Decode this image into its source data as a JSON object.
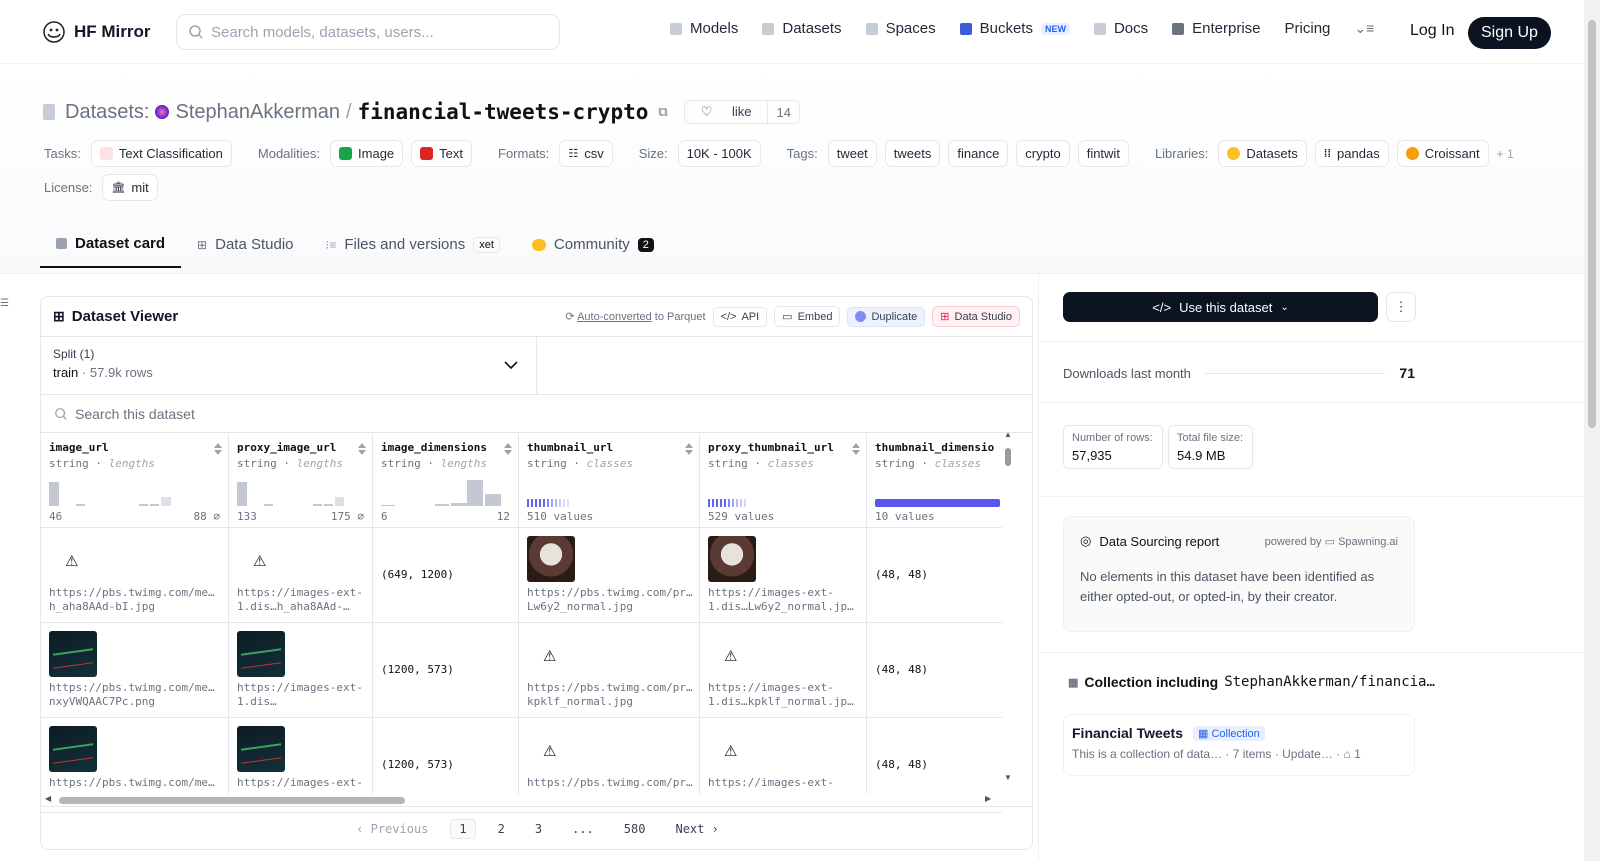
{
  "header": {
    "brand": "HF Mirror",
    "search_placeholder": "Search models, datasets, users...",
    "nav": [
      {
        "label": "Models",
        "icon": "cube-icon"
      },
      {
        "label": "Datasets",
        "icon": "database-icon"
      },
      {
        "label": "Spaces",
        "icon": "grid-icon"
      },
      {
        "label": "Buckets",
        "icon": "bucket-icon",
        "badge": "NEW"
      },
      {
        "label": "Docs",
        "icon": "book-icon"
      },
      {
        "label": "Enterprise",
        "icon": "briefcase-icon"
      },
      {
        "label": "Pricing"
      }
    ],
    "login": "Log In",
    "signup": "Sign Up"
  },
  "repo": {
    "prefix": "Datasets:",
    "owner": "StephanAkkerman",
    "sep": "/",
    "name": "financial-tweets-crypto",
    "like_label": "like",
    "like_count": "14"
  },
  "tags": {
    "tasks_label": "Tasks:",
    "tasks": [
      "Text Classification"
    ],
    "modalities_label": "Modalities:",
    "modalities": [
      "Image",
      "Text"
    ],
    "formats_label": "Formats:",
    "formats": [
      "csv"
    ],
    "size_label": "Size:",
    "size": [
      "10K - 100K"
    ],
    "tags_label": "Tags:",
    "tags": [
      "tweet",
      "tweets",
      "finance",
      "crypto",
      "fintwit"
    ],
    "libraries_label": "Libraries:",
    "libraries": [
      "Datasets",
      "pandas",
      "Croissant"
    ],
    "libraries_more": "+ 1",
    "license_label": "License:",
    "license": "mit"
  },
  "tabs": [
    {
      "label": "Dataset card",
      "active": true
    },
    {
      "label": "Data Studio"
    },
    {
      "label": "Files and versions",
      "badge": "xet"
    },
    {
      "label": "Community",
      "badge": "2"
    }
  ],
  "viewer": {
    "title": "Dataset Viewer",
    "auto_converted": "Auto-converted",
    "to_parquet": "to Parquet",
    "api": "API",
    "embed": "Embed",
    "duplicate": "Duplicate",
    "data_studio": "Data Studio",
    "split_label": "Split (1)",
    "split_name": "train",
    "split_rows": "57.9k rows",
    "search_placeholder": "Search this dataset",
    "columns": [
      {
        "name": "image_url",
        "type": "string",
        "stat": "lengths",
        "min": "46",
        "max": "88"
      },
      {
        "name": "proxy_image_url",
        "type": "string",
        "stat": "lengths",
        "min": "133",
        "max": "175"
      },
      {
        "name": "image_dimensions",
        "type": "string",
        "stat": "lengths",
        "min": "6",
        "max": "12"
      },
      {
        "name": "thumbnail_url",
        "type": "string",
        "stat": "classes",
        "values": "510 values"
      },
      {
        "name": "proxy_thumbnail_url",
        "type": "string",
        "stat": "classes",
        "values": "529 values"
      },
      {
        "name": "thumbnail_dimensions",
        "type": "string",
        "stat": "classes",
        "values": "10 values"
      }
    ],
    "rows": [
      {
        "image_url": "https://pbs.twimg.com/me…h_aha8AAd-bI.jpg",
        "proxy_image_url": "https://images-ext-1.dis…h_aha8AAd-…",
        "image_dimensions": "(649, 1200)",
        "thumbnail_url": "https://pbs.twimg.com/pr…Lw6y2_normal.jpg",
        "proxy_thumbnail_url": "https://images-ext-1.dis…Lw6y2_normal.jp…",
        "thumbnail_dimensions": "(48, 48)"
      },
      {
        "image_url": "https://pbs.twimg.com/me…nxyVWQAAC7Pc.png",
        "proxy_image_url": "https://images-ext-1.dis…",
        "image_dimensions": "(1200, 573)",
        "thumbnail_url": "https://pbs.twimg.com/pr…kpklf_normal.jpg",
        "proxy_thumbnail_url": "https://images-ext-1.dis…kpklf_normal.jp…",
        "thumbnail_dimensions": "(48, 48)"
      },
      {
        "image_url": "https://pbs.twimg.com/me…",
        "proxy_image_url": "https://images-ext-",
        "image_dimensions": "(1200, 573)",
        "thumbnail_url": "https://pbs.twimg.com/pr…",
        "proxy_thumbnail_url": "https://images-ext-",
        "thumbnail_dimensions": "(48, 48)"
      }
    ],
    "pager": {
      "previous": "Previous",
      "pages": [
        "1",
        "2",
        "3",
        "...",
        "580"
      ],
      "next": "Next"
    }
  },
  "sidebar": {
    "use_button": "Use this dataset",
    "downloads_label": "Downloads last month",
    "downloads_value": "71",
    "rows_label": "Number of rows:",
    "rows_value": "57,935",
    "size_label": "Total file size:",
    "size_value": "54.9 MB",
    "report_title": "Data Sourcing report",
    "powered_by": "powered by",
    "powered_name": "Spawning.ai",
    "report_body": "No elements in this dataset have been identified as either opted-out, or opted-in, by their creator.",
    "collection_prefix": "Collection including",
    "collection_repo": "StephanAkkerman/financia…",
    "collection_name": "Financial Tweets",
    "collection_badge": "Collection",
    "collection_desc": "This is a collection of data…",
    "collection_items": "7 items",
    "collection_updated": "Update…",
    "collection_upvotes": "1"
  }
}
